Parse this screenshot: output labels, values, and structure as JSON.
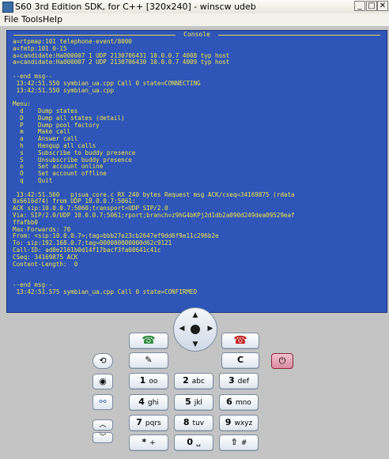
{
  "window": {
    "title": "S60 3rd Edition SDK, for C++ [320x240] - winscw udeb",
    "minimize": "_",
    "maximize": "□",
    "close": "✕"
  },
  "menubar": {
    "file": "File",
    "tools": "Tools",
    "help": "Help"
  },
  "console": {
    "title": "Console",
    "lines": [
      "a=rtpmap:101 telephone-event/8000",
      "a=fmtp:101 0-15",
      "a=candidate:Ha000007 1 UDP 2130706431 10.0.0.7 4008 typ host",
      "a=candidate:Ha000007 2 UDP 2130706430 10.0.0.7 4009 typ host",
      "",
      "--end msg--",
      " 13:42:51.550 symbian_ua.cpp Call 0 state=CONNECTING",
      " 13:42:51.550 symbian_ua.cpp",
      "",
      "Menu:",
      "  d    Dump states",
      "  D    Dump all states (detail)",
      "  P    Dump pool factory",
      "  m    Make call",
      "  a    Answer call",
      "  h    Hangup all calls",
      "  s    Subscribe to buddy presence",
      "  S    Unsubscribe buddy presence",
      "  o    Set account online",
      "  O    Set account offline",
      "  q    Quit",
      "",
      " 13:42:51.560   pjsua_core.c RX 240 bytes Request msg ACK/cseq=34169875 (rdata",
      "0x6616d74) from UDP 10.0.0.7:5061:",
      "ACK sip:10.0.0.7:5060;transport=UDP SIP/2.0",
      "Via: SIP/2.0/UDP 10.0.0.7:5061;rport;branch=z9hG4bKPj2d1db2a090d249dea09529eaf",
      "ffafbb0",
      "Max-Forwards: 70",
      "From: <sip:10.0.0.7>;tag=bbb27e23cb2647ef9dd6f9e11c296b2e",
      "To: sip:192.168.0.7;tag=000000000000d62c9121",
      "Call-ID: ad0e2161b0d14f17bacf3fa08641c41c",
      "CSeq: 34169875 ACK",
      "Content-Length:  0",
      "",
      "",
      "--end msg--",
      " 13:42:51.575 symbian_ua.cpp Call 0 state=CONFIRMED"
    ]
  },
  "keypad": {
    "call": "☎",
    "end": "☎",
    "pencil": "✎",
    "clear": "C",
    "k1": {
      "num": "1",
      "sub": "oo"
    },
    "k2": {
      "num": "2",
      "sub": "abc"
    },
    "k3": {
      "num": "3",
      "sub": "def"
    },
    "k4": {
      "num": "4",
      "sub": "ghi"
    },
    "k5": {
      "num": "5",
      "sub": "jkl"
    },
    "k6": {
      "num": "6",
      "sub": "mno"
    },
    "k7": {
      "num": "7",
      "sub": "pqrs"
    },
    "k8": {
      "num": "8",
      "sub": "tuv"
    },
    "k9": {
      "num": "9",
      "sub": "wxyz"
    },
    "kstar": {
      "num": "*",
      "sub": "+"
    },
    "k0": {
      "num": "0",
      "sub": "␣"
    },
    "khash": {
      "num": "⇧",
      "sub": "#"
    },
    "menu": "⟲",
    "camera": "◉",
    "apps": "⚯",
    "up": "︿",
    "down": "﹀",
    "power": "⏻"
  },
  "colors": {
    "console_bg": "#2e55b7",
    "console_text": "#f2e54c",
    "power": "#d98aa0"
  }
}
